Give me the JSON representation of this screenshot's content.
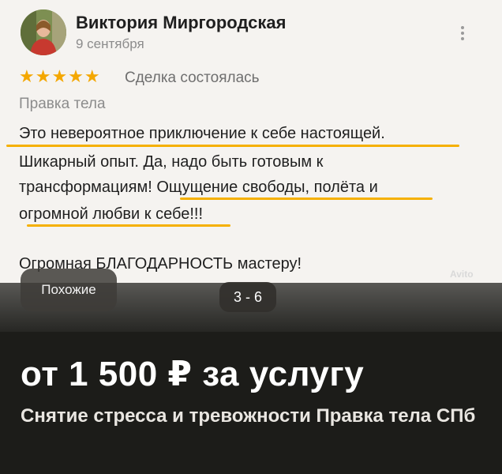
{
  "review": {
    "author": "Виктория Миргородская",
    "date": "9 сентября",
    "stars": "★★★★★",
    "rating": 5,
    "deal_status": "Сделка состоялась",
    "category": "Правка тела",
    "text_lines": [
      "Это невероятное приключение к себе настоящей.",
      "Шикарный опыт. Да, надо быть готовым к",
      "трансформациям!  Ощущение свободы, полёта и",
      "огромной любви к себе!!!",
      "Огромная БЛАГОДАРНОСТЬ мастеру!"
    ],
    "highlight_color": "#f5b000"
  },
  "gallery": {
    "similar_label": "Похожие",
    "counter": "3 - 6",
    "watermark": "Avito"
  },
  "listing": {
    "price": "от 1 500 ₽ за услугу",
    "title": "Снятие стресса и тревожности Правка тела СПб"
  }
}
